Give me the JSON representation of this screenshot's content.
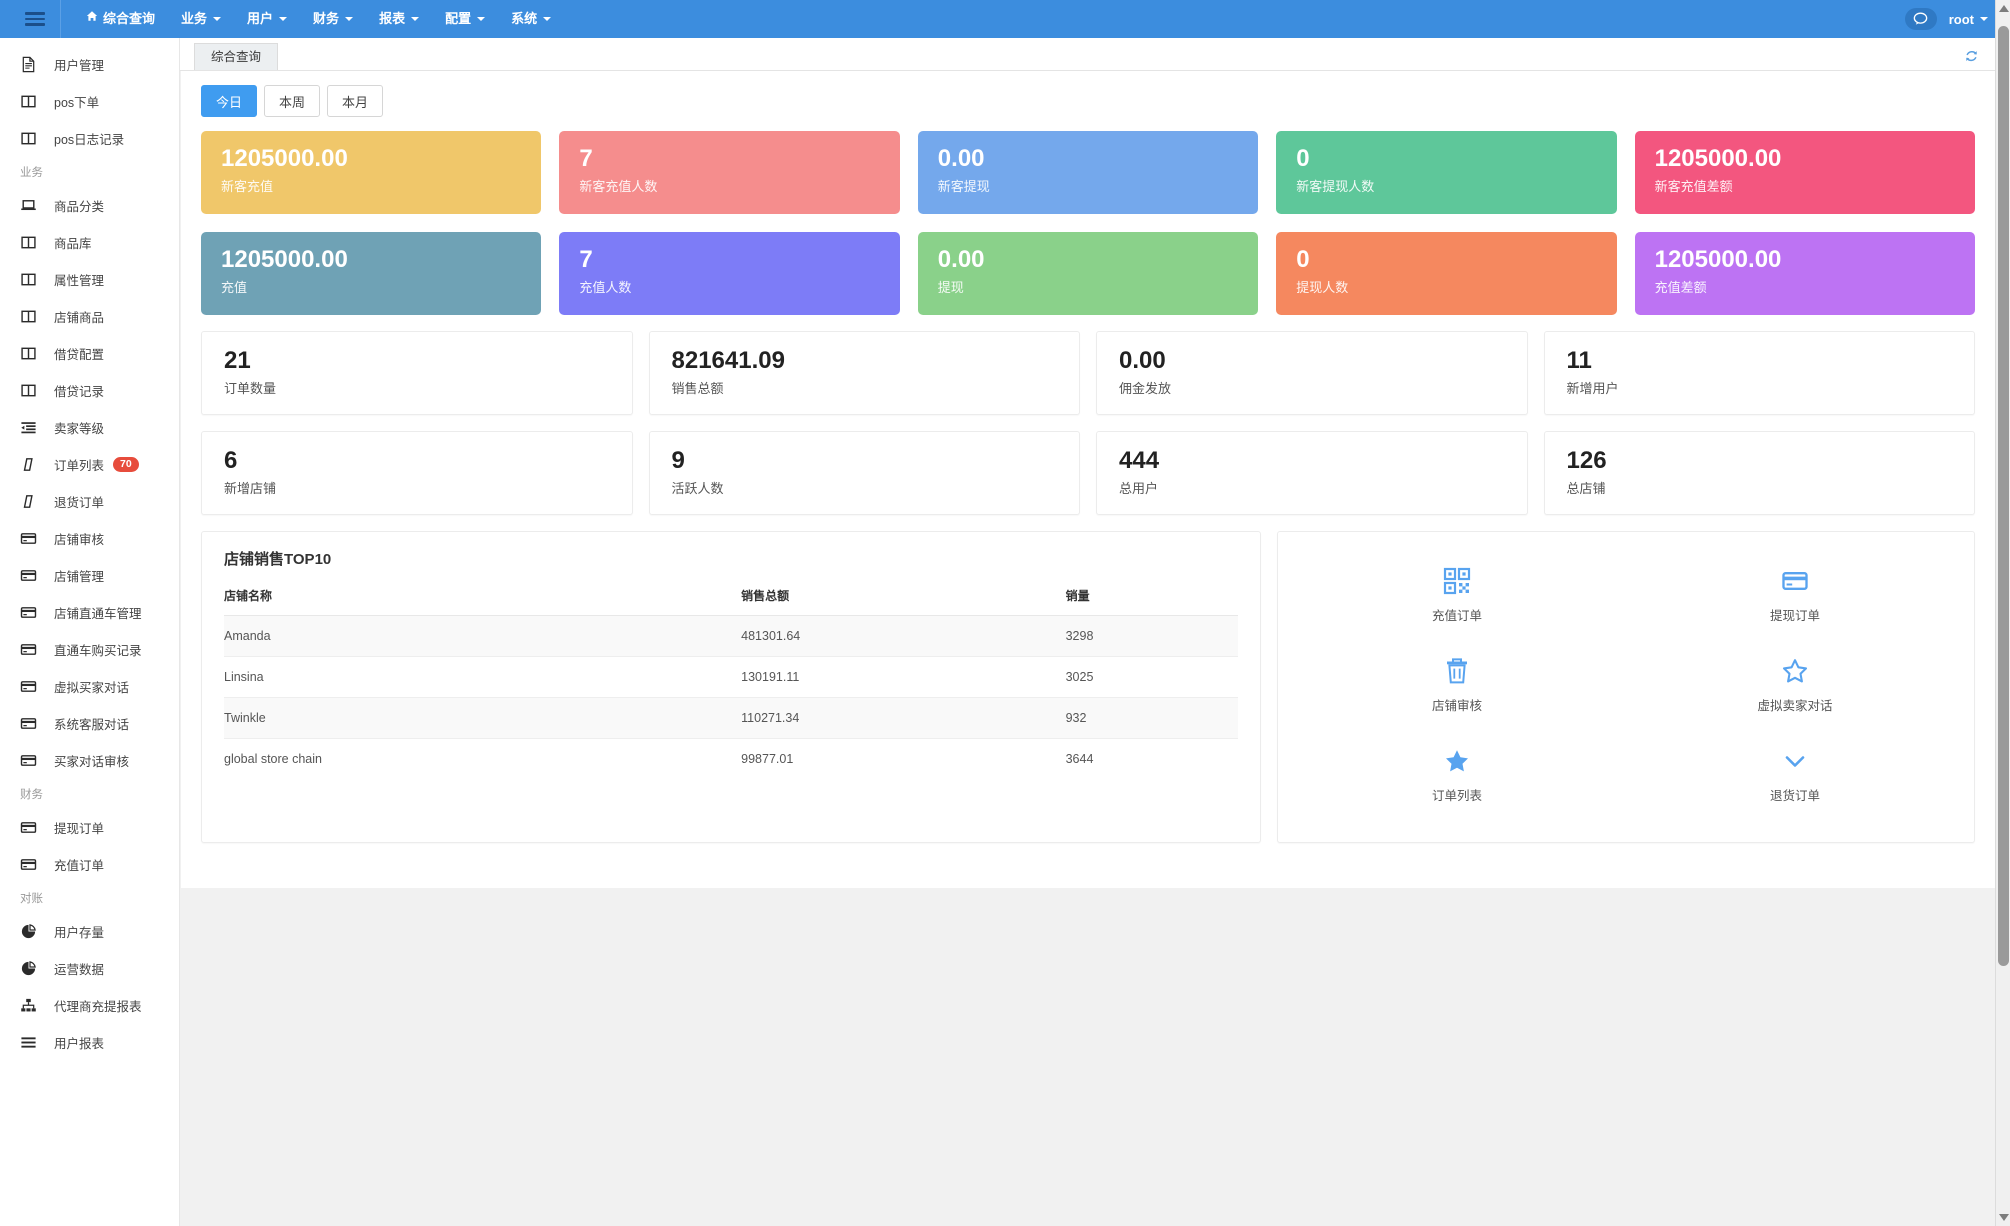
{
  "navbar": {
    "hamburger_icon": "hamburger-icon",
    "items": [
      {
        "label": "综合查询",
        "icon": "home-icon",
        "caret": false,
        "active": true
      },
      {
        "label": "业务",
        "caret": true
      },
      {
        "label": "用户",
        "caret": true
      },
      {
        "label": "财务",
        "caret": true
      },
      {
        "label": "报表",
        "caret": true
      },
      {
        "label": "配置",
        "caret": true
      },
      {
        "label": "系统",
        "caret": true
      }
    ],
    "chat_icon": "chat-bubble-icon",
    "user": "root"
  },
  "tabstrip": {
    "tabs": [
      {
        "label": "综合查询",
        "active": true
      }
    ],
    "refresh_icon": "refresh-icon"
  },
  "sidebar": {
    "sections": [
      {
        "group": null,
        "items": [
          {
            "label": "用户管理",
            "icon": "document-icon"
          },
          {
            "label": "pos下单",
            "icon": "columns-icon"
          },
          {
            "label": "pos日志记录",
            "icon": "columns-icon"
          }
        ]
      },
      {
        "group": "业务",
        "items": [
          {
            "label": "商品分类",
            "icon": "laptop-icon"
          },
          {
            "label": "商品库",
            "icon": "columns-icon"
          },
          {
            "label": "属性管理",
            "icon": "columns-icon"
          },
          {
            "label": "店铺商品",
            "icon": "columns-icon"
          },
          {
            "label": "借贷配置",
            "icon": "columns-icon"
          },
          {
            "label": "借贷记录",
            "icon": "columns-icon"
          },
          {
            "label": "卖家等级",
            "icon": "indent-icon"
          },
          {
            "label": "订单列表",
            "icon": "tilted-rect-icon",
            "badge": "70"
          },
          {
            "label": "退货订单",
            "icon": "tilted-rect-icon"
          },
          {
            "label": "店铺审核",
            "icon": "credit-card-icon"
          },
          {
            "label": "店铺管理",
            "icon": "credit-card-icon"
          },
          {
            "label": "店铺直通车管理",
            "icon": "credit-card-icon"
          },
          {
            "label": "直通车购买记录",
            "icon": "credit-card-icon"
          },
          {
            "label": "虚拟买家对话",
            "icon": "credit-card-icon"
          },
          {
            "label": "系统客服对话",
            "icon": "credit-card-icon"
          },
          {
            "label": "买家对话审核",
            "icon": "credit-card-icon"
          }
        ]
      },
      {
        "group": "财务",
        "items": [
          {
            "label": "提现订单",
            "icon": "credit-card-icon"
          },
          {
            "label": "充值订单",
            "icon": "credit-card-icon"
          }
        ]
      },
      {
        "group": "对账",
        "items": [
          {
            "label": "用户存量",
            "icon": "pie-chart-icon"
          },
          {
            "label": "运营数据",
            "icon": "pie-chart-icon"
          },
          {
            "label": "代理商充提报表",
            "icon": "sitemap-icon"
          },
          {
            "label": "用户报表",
            "icon": "list-icon"
          }
        ]
      }
    ]
  },
  "main": {
    "period_buttons": [
      {
        "label": "今日",
        "active": true
      },
      {
        "label": "本周",
        "active": false
      },
      {
        "label": "本月",
        "active": false
      }
    ],
    "color_cards": [
      {
        "value": "1205000.00",
        "label": "新客充值",
        "color": "#f0c濾"
      },
      {
        "value": "7",
        "label": "新客充值人数",
        "color": "#f58d8d"
      },
      {
        "value": "0.00",
        "label": "新客提现",
        "color": "#74a8ec"
      },
      {
        "value": "0",
        "label": "新客提现人数",
        "color": "#5ec79a"
      },
      {
        "value": "1205000.00",
        "label": "新客充值差额",
        "color": "#f3567f"
      },
      {
        "value": "1205000.00",
        "label": "充值",
        "color": "#6fa2b5"
      },
      {
        "value": "7",
        "label": "充值人数",
        "color": "#7d7cf7"
      },
      {
        "value": "0.00",
        "label": "提现",
        "color": "#8ad18a"
      },
      {
        "value": "0",
        "label": "提现人数",
        "color": "#f5885f"
      },
      {
        "value": "1205000.00",
        "label": "充值差额",
        "color": "#bd73f3"
      }
    ],
    "white_cards": [
      {
        "value": "21",
        "label": "订单数量"
      },
      {
        "value": "821641.09",
        "label": "销售总额"
      },
      {
        "value": "0.00",
        "label": "佣金发放"
      },
      {
        "value": "11",
        "label": "新增用户"
      },
      {
        "value": "6",
        "label": "新增店铺"
      },
      {
        "value": "9",
        "label": "活跃人数"
      },
      {
        "value": "444",
        "label": "总用户"
      },
      {
        "value": "126",
        "label": "总店铺"
      }
    ],
    "top10": {
      "title": "店铺销售TOP10",
      "columns": [
        "店铺名称",
        "销售总额",
        "销量"
      ],
      "rows": [
        [
          "Amanda",
          "481301.64",
          "3298"
        ],
        [
          "Linsina",
          "130191.11",
          "3025"
        ],
        [
          "Twinkle",
          "110271.34",
          "932"
        ],
        [
          "global store chain",
          "99877.01",
          "3644"
        ]
      ]
    },
    "quick_links": [
      {
        "label": "充值订单",
        "icon": "qrcode-icon"
      },
      {
        "label": "提现订单",
        "icon": "credit-card-icon"
      },
      {
        "label": "店铺审核",
        "icon": "trash-icon"
      },
      {
        "label": "虚拟卖家对话",
        "icon": "star-outline-icon"
      },
      {
        "label": "订单列表",
        "icon": "star-filled-icon"
      },
      {
        "label": "退货订单",
        "icon": "chevron-down-icon"
      }
    ]
  },
  "colors": {
    "navbar": "#3c8dde",
    "accent": "#3f9cf0",
    "badge": "#e74c3c",
    "card1": "#f0c76a",
    "card2": "#f58d8d",
    "card3": "#74a8ec",
    "card4": "#5ec79a",
    "card5": "#f3567f",
    "card6": "#6fa2b5",
    "card7": "#7d7cf7",
    "card8": "#8ad18a",
    "card9": "#f5885f",
    "card10": "#bd73f3"
  }
}
